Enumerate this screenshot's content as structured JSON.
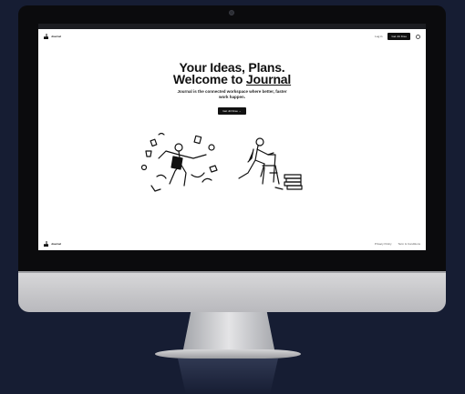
{
  "site": {
    "brand": "Journal",
    "nav": {
      "login": "Log in",
      "cta": "Get Jnl Free"
    },
    "hero": {
      "title_line1": "Your Ideas, Plans.",
      "title_prefix": "Welcome to ",
      "title_highlight": "Journal",
      "subtitle": "Journal is the connected workspace where better, faster work happen.",
      "button": "Get Jnl Free →"
    },
    "footer": {
      "brand": "Journal",
      "links": [
        "Privacy Policy",
        "Term & Conditions"
      ]
    }
  },
  "icons": {
    "logo": "journal-logo-icon",
    "theme": "moon-icon"
  },
  "colors": {
    "background": "#161d33",
    "screen": "#ffffff",
    "accent": "#111111"
  }
}
